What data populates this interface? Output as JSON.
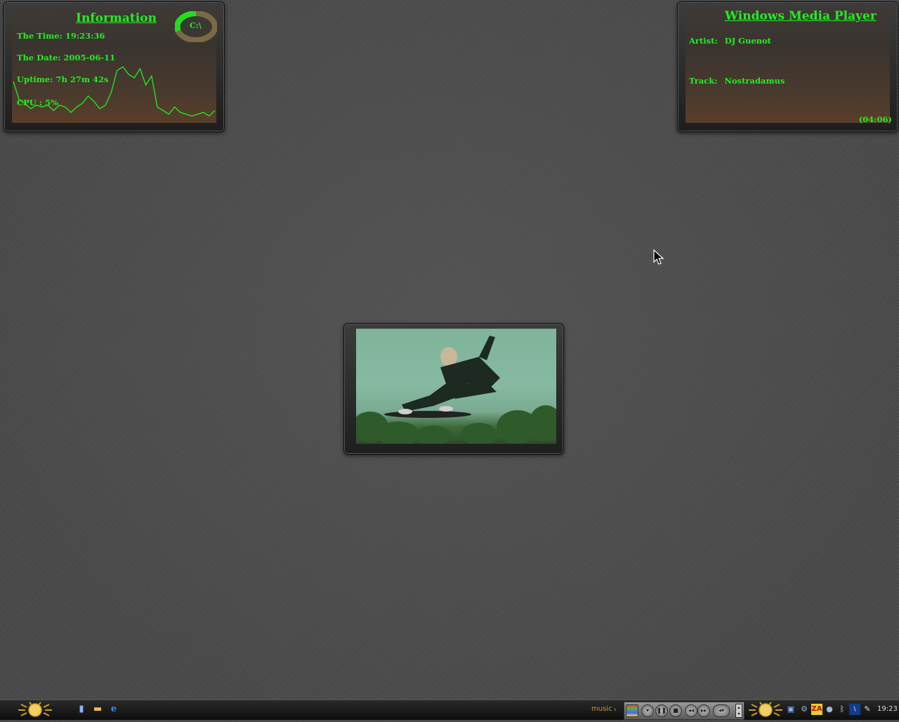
{
  "info_widget": {
    "title": "Information",
    "drive_label": "C:\\",
    "time_line": "The Time: 19:23:36",
    "date_line": "The Date: 2005-06-11",
    "uptime_line": "Uptime: 7h 27m 42s",
    "cpu_line": "CPU : 5%",
    "cpu_history": [
      22,
      12,
      10,
      7,
      9,
      8,
      9,
      6,
      9,
      8,
      5,
      8,
      10,
      14,
      11,
      7,
      9,
      16,
      28,
      30,
      26,
      24,
      29,
      20,
      25,
      8,
      6,
      4,
      8,
      5,
      4,
      3,
      4,
      5,
      3,
      6
    ],
    "accent_color": "#22ee22"
  },
  "wmp_widget": {
    "title": "Windows Media Player",
    "artist_label": "Artist:",
    "artist_value": "DJ Guenot",
    "track_label": "Track:",
    "track_value": "Nostradamus",
    "duration": "(04:06)"
  },
  "video_widget": {
    "content": "skateboarder-video-frame"
  },
  "taskbar": {
    "start_icon": "sun-logo-icon",
    "quicklaunch": [
      "show-desktop-icon",
      "folder-icon",
      "internet-explorer-icon"
    ],
    "music_label": "music",
    "media_controls": [
      "windows-logo-icon",
      "menu-icon",
      "pause-icon",
      "stop-icon",
      "previous-icon",
      "next-icon",
      "volume-icon"
    ],
    "tray_icons": [
      "network-icon",
      "network-connections-icon",
      "zonealarm-icon",
      "globe-icon",
      "bluetooth-icon",
      "antivirus-icon",
      "safely-remove-icon"
    ],
    "clock": "19:23"
  }
}
